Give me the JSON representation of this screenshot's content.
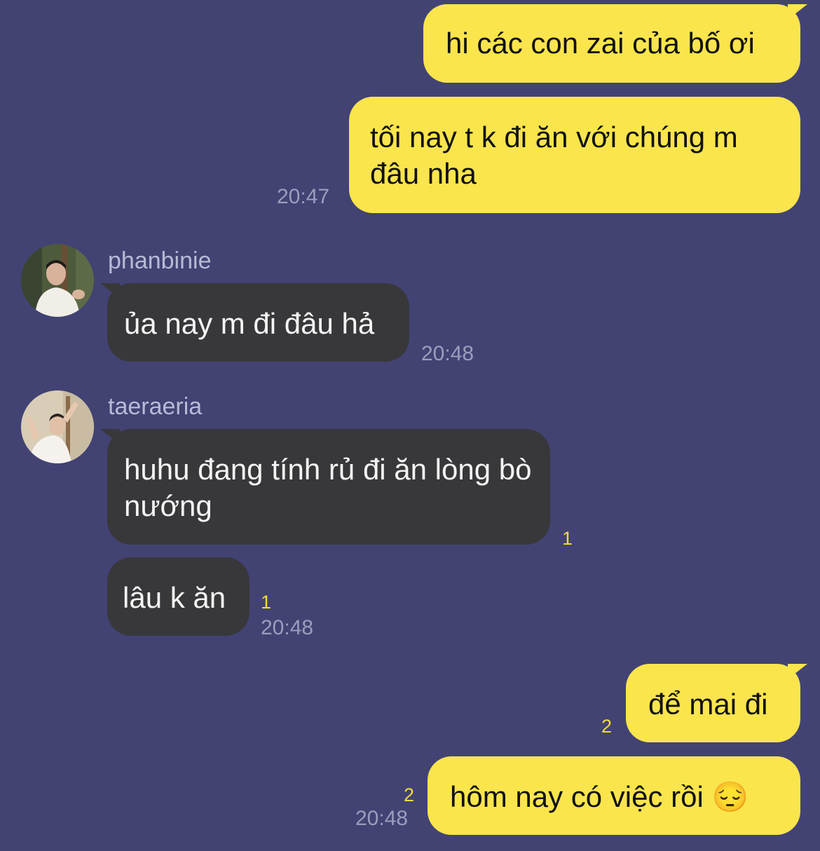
{
  "messages": {
    "m1": {
      "text": "hi các con zai của bố ơi"
    },
    "m2": {
      "text": "tối nay t k đi ăn với chúng m đâu nha",
      "time": "20:47"
    },
    "m3": {
      "sender": "phanbinie",
      "text": "ủa nay m đi đâu hả",
      "time": "20:48"
    },
    "m4": {
      "sender": "taeraeria",
      "text": "huhu đang tính rủ đi ăn lòng bò nướng",
      "unread": "1"
    },
    "m5": {
      "text": "lâu k ăn",
      "unread": "1",
      "time": "20:48"
    },
    "m6": {
      "text": "để mai đi",
      "unread": "2"
    },
    "m7": {
      "text": "hôm nay có việc rồi 😔",
      "unread": "2",
      "time": "20:48"
    }
  },
  "colors": {
    "background": "#424373",
    "my_bubble": "#FAE54D",
    "their_bubble": "#38383b",
    "unread_count": "#f2dc3c",
    "timestamp": "#9c9dbd"
  },
  "icons": {
    "avatar_phanbinie": "profile-photo",
    "avatar_taeraeria": "profile-photo"
  }
}
